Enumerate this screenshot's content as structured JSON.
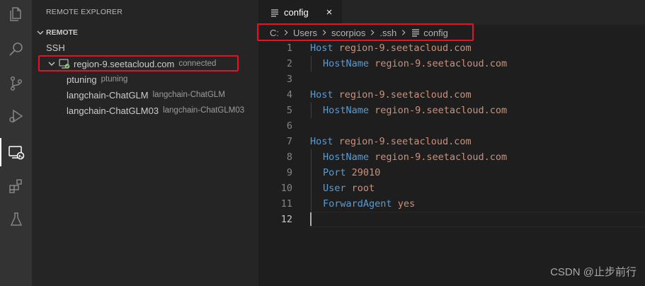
{
  "sidebar": {
    "title": "REMOTE EXPLORER",
    "section": "REMOTE",
    "group": "SSH",
    "host": {
      "label": "region-9.seetacloud.com",
      "status": "connected"
    },
    "folders": [
      {
        "label": "ptuning",
        "desc": "ptuning"
      },
      {
        "label": "langchain-ChatGLM",
        "desc": "langchain-ChatGLM"
      },
      {
        "label": "langchain-ChatGLM03",
        "desc": "langchain-ChatGLM03"
      }
    ]
  },
  "editor": {
    "tab": {
      "label": "config"
    },
    "breadcrumb": [
      "C:",
      "Users",
      "scorpios",
      ".ssh",
      "config"
    ],
    "lines": [
      {
        "num": "1",
        "key": "Host",
        "value": "region-9.seetacloud.com",
        "indent": false
      },
      {
        "num": "2",
        "key": "HostName",
        "value": "region-9.seetacloud.com",
        "indent": true
      },
      {
        "num": "3",
        "key": "",
        "value": "",
        "indent": false
      },
      {
        "num": "4",
        "key": "Host",
        "value": "region-9.seetacloud.com",
        "indent": false
      },
      {
        "num": "5",
        "key": "HostName",
        "value": "region-9.seetacloud.com",
        "indent": true
      },
      {
        "num": "6",
        "key": "",
        "value": "",
        "indent": false
      },
      {
        "num": "7",
        "key": "Host",
        "value": "region-9.seetacloud.com",
        "indent": false
      },
      {
        "num": "8",
        "key": "HostName",
        "value": "region-9.seetacloud.com",
        "indent": true
      },
      {
        "num": "9",
        "key": "Port",
        "value": "29010",
        "indent": true
      },
      {
        "num": "10",
        "key": "User",
        "value": "root",
        "indent": true
      },
      {
        "num": "11",
        "key": "ForwardAgent",
        "value": "yes",
        "indent": true
      },
      {
        "num": "12",
        "key": "",
        "value": "",
        "indent": false
      }
    ]
  },
  "watermark": "CSDN @止步前行",
  "colors": {
    "keyword": "#569cd6",
    "string": "#ce9178",
    "highlight_box": "#e81123",
    "connected": "#89d185"
  },
  "icons": [
    "files-icon",
    "search-icon",
    "source-control-icon",
    "run-debug-icon",
    "remote-explorer-icon",
    "extensions-icon",
    "testing-icon"
  ]
}
